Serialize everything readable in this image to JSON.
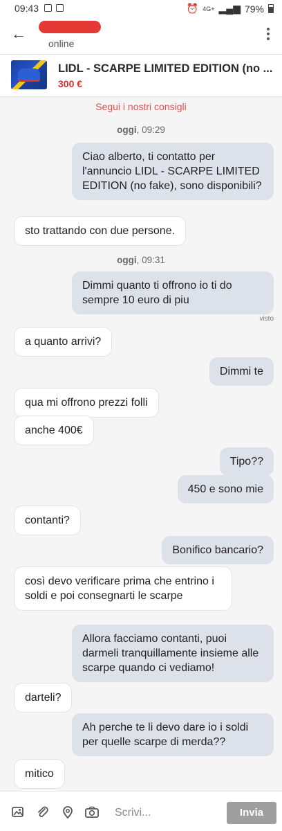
{
  "status_bar": {
    "time": "09:43",
    "network": "4G+",
    "battery": "79%"
  },
  "header": {
    "status": "online"
  },
  "listing": {
    "title": "LIDL - SCARPE LIMITED EDITION (no ...",
    "price": "300 €"
  },
  "chat": {
    "tips_link": "Segui i nostri consigli",
    "day_1": {
      "label": "oggi",
      "time": ", 09:29"
    },
    "day_2": {
      "label": "oggi",
      "time": ", 09:31"
    },
    "seen_label": "visto",
    "messages": [
      {
        "side": "out",
        "text": "Ciao alberto, ti contatto per l'annuncio LIDL - SCARPE LIMITED EDITION (no fake), sono disponibili?"
      },
      {
        "side": "in",
        "text": "sto trattando con due persone."
      },
      {
        "side": "out",
        "text": "Dimmi quanto ti offrono io ti do sempre 10 euro di piu"
      },
      {
        "side": "in",
        "text": "a quanto arrivi?"
      },
      {
        "side": "out",
        "text": "Dimmi te"
      },
      {
        "side": "in",
        "text": "qua mi offrono prezzi folli"
      },
      {
        "side": "in",
        "text": "anche 400€"
      },
      {
        "side": "out",
        "text": "Tipo??"
      },
      {
        "side": "out",
        "text": "450 e sono mie"
      },
      {
        "side": "in",
        "text": "contanti?"
      },
      {
        "side": "out",
        "text": "Bonifico bancario?"
      },
      {
        "side": "in",
        "text": "così devo verificare prima che entrino i soldi e poi consegnarti le scarpe"
      },
      {
        "side": "out",
        "text": "Allora facciamo contanti, puoi darmeli tranquillamente insieme alle scarpe quando ci vediamo!"
      },
      {
        "side": "in",
        "text": "darteli?"
      },
      {
        "side": "out",
        "text": "Ah perche te li devo dare io i soldi per quelle scarpe di merda??"
      },
      {
        "side": "in",
        "text": "mitico"
      }
    ]
  },
  "composer": {
    "placeholder": "Scrivi...",
    "send_label": "Invia"
  },
  "colors": {
    "accent": "#d32f2f",
    "outgoing_bubble": "#dde1ea",
    "incoming_bubble": "#ffffff",
    "chat_background": "#f5f5f5"
  },
  "icons": [
    "back-arrow-icon",
    "more-vert-icon",
    "gallery-icon",
    "attachment-icon",
    "location-icon",
    "camera-icon"
  ]
}
